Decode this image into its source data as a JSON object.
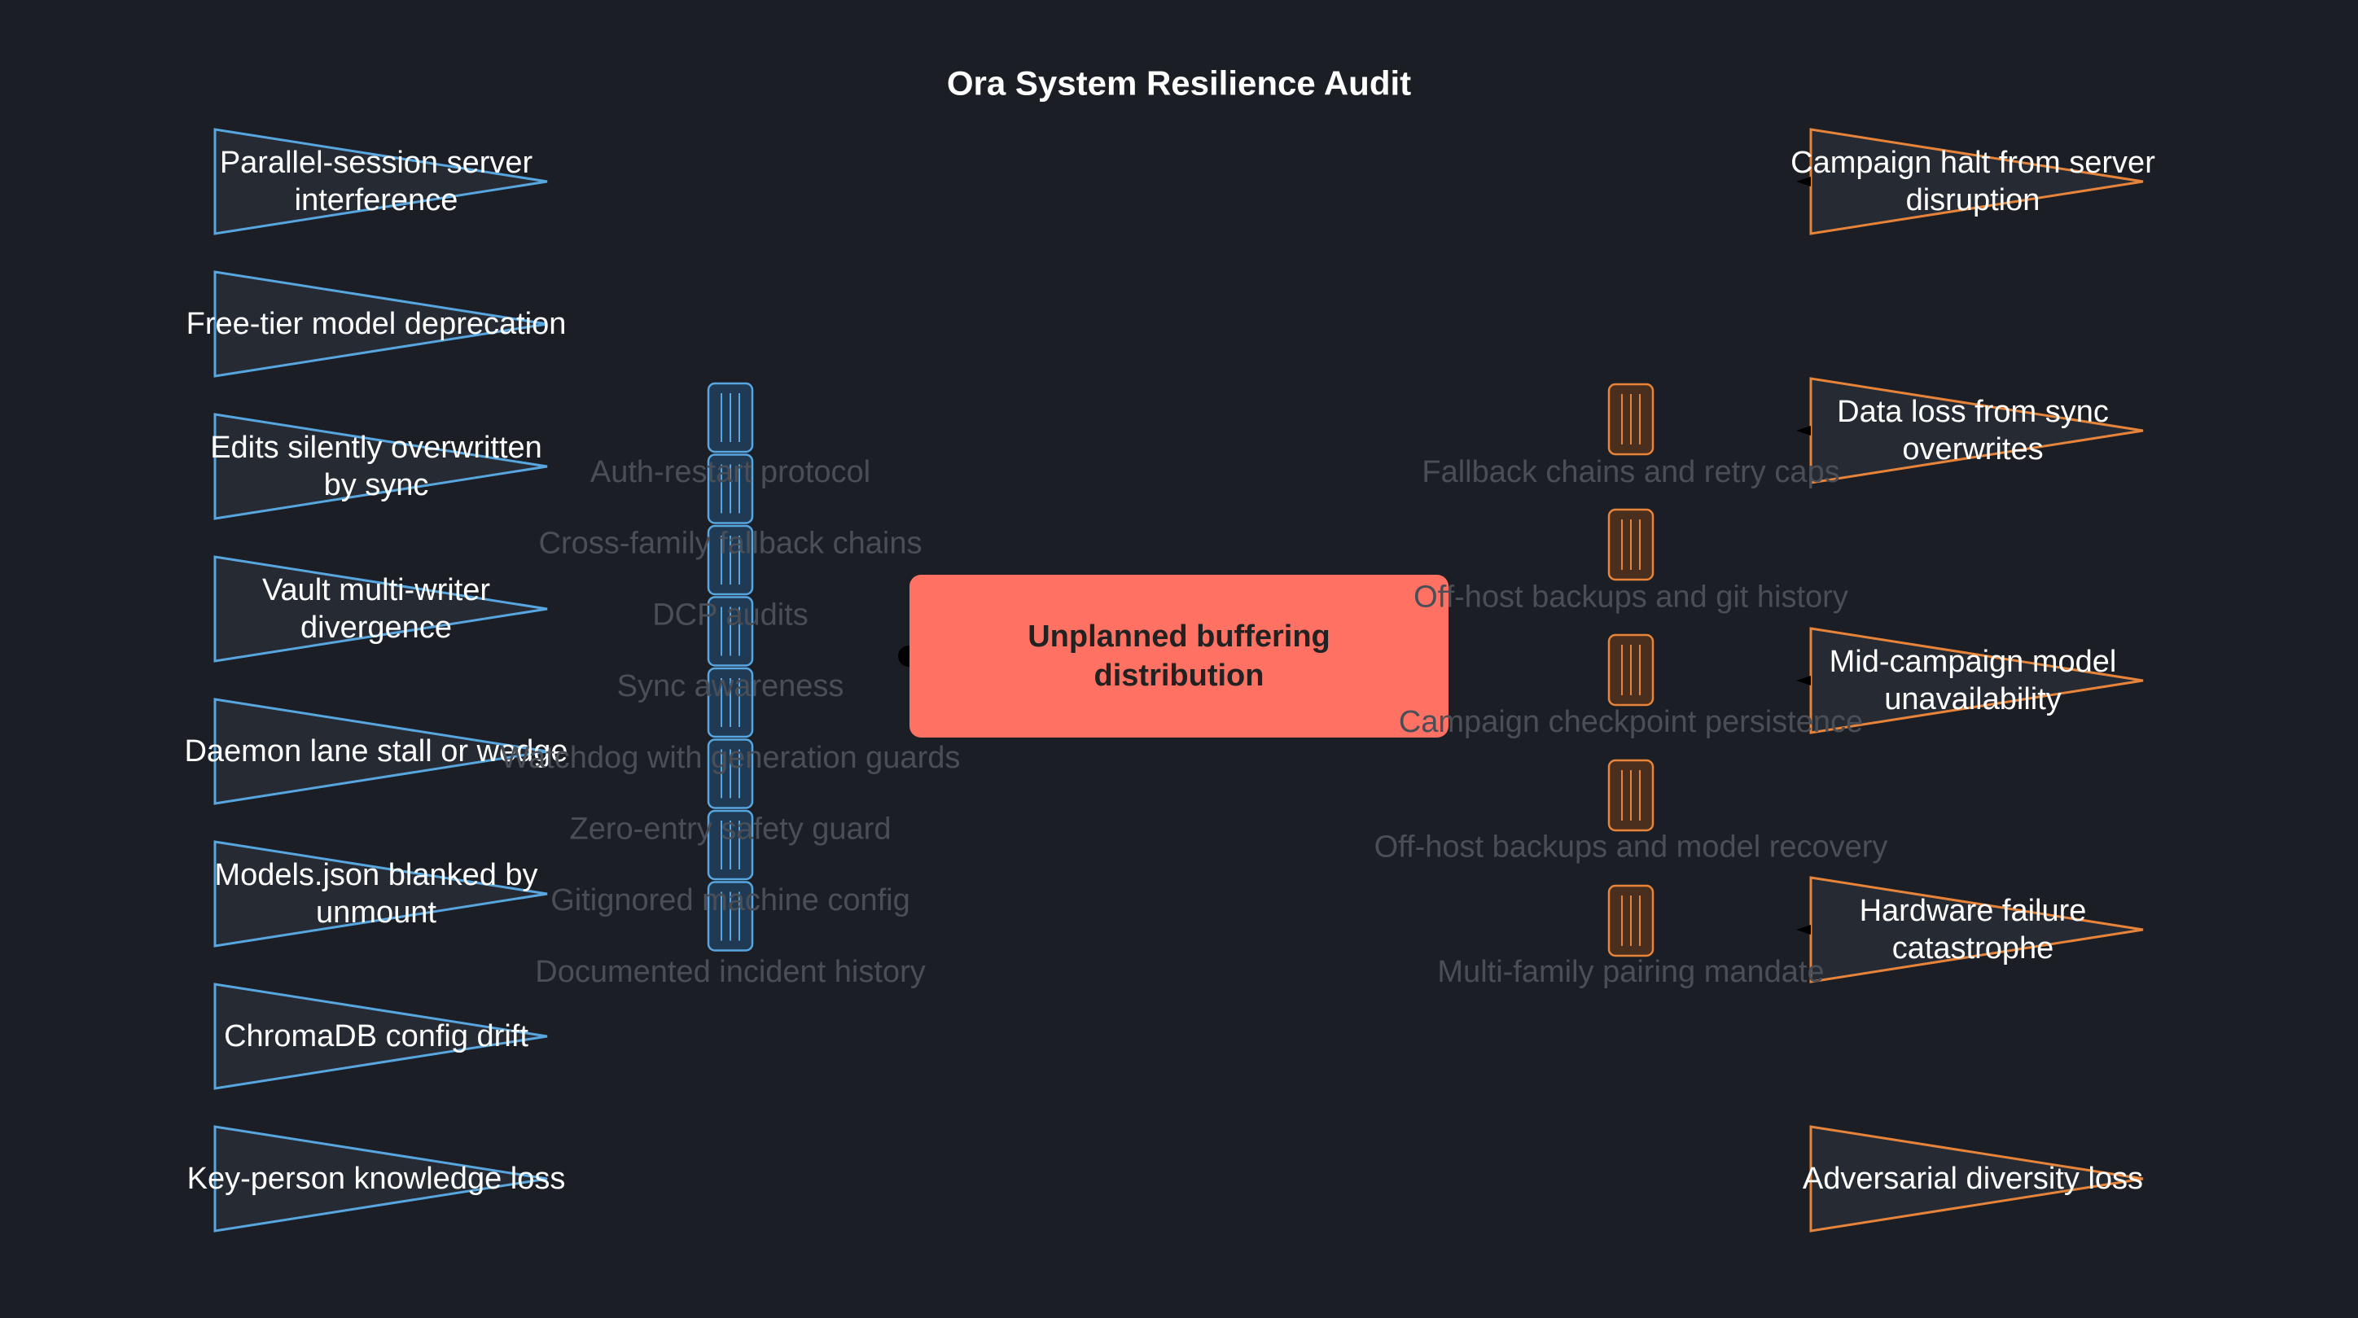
{
  "diagram": {
    "title": "Ora System Resilience Audit",
    "top_event": {
      "lines": [
        "Unplanned buffering",
        "distribution"
      ]
    },
    "threats": [
      {
        "lines": [
          "Parallel-session server",
          "interference"
        ]
      },
      {
        "lines": [
          "Free-tier model deprecation"
        ]
      },
      {
        "lines": [
          "Edits silently overwritten",
          "by sync"
        ]
      },
      {
        "lines": [
          "Vault multi-writer",
          "divergence"
        ]
      },
      {
        "lines": [
          "Daemon lane stall or wedge"
        ]
      },
      {
        "lines": [
          "Models.json blanked by",
          "unmount"
        ]
      },
      {
        "lines": [
          "ChromaDB config drift"
        ]
      },
      {
        "lines": [
          "Key-person knowledge loss"
        ]
      }
    ],
    "preventive_barriers": [
      "Auth-restart protocol",
      "Cross-family fallback chains",
      "DCP audits",
      "Sync awareness",
      "Watchdog with generation guards",
      "Zero-entry safety guard",
      "Gitignored machine config",
      "Documented incident history"
    ],
    "mitigation_barriers": [
      "Fallback chains and retry caps",
      "Off-host backups and git history",
      "Campaign checkpoint persistence",
      "Off-host backups and model recovery",
      "Multi-family pairing mandate"
    ],
    "consequences": [
      {
        "lines": [
          "Campaign halt from server",
          "disruption"
        ]
      },
      {
        "lines": [
          "Data loss from sync",
          "overwrites"
        ]
      },
      {
        "lines": [
          "Mid-campaign model",
          "unavailability"
        ]
      },
      {
        "lines": [
          "Hardware failure",
          "catastrophe"
        ]
      },
      {
        "lines": [
          "Adversarial diversity loss"
        ]
      }
    ],
    "colors": {
      "background": "#1b1e25",
      "threat_stroke": "#58a6e0",
      "consequence_stroke": "#e8843a",
      "shape_fill": "#252a33",
      "top_event_fill": "#ff7163",
      "barrier_text": "#4a4e57",
      "preventive_block_fill": "#1f3a52",
      "mitigation_block_fill": "#4a2e1e"
    }
  }
}
